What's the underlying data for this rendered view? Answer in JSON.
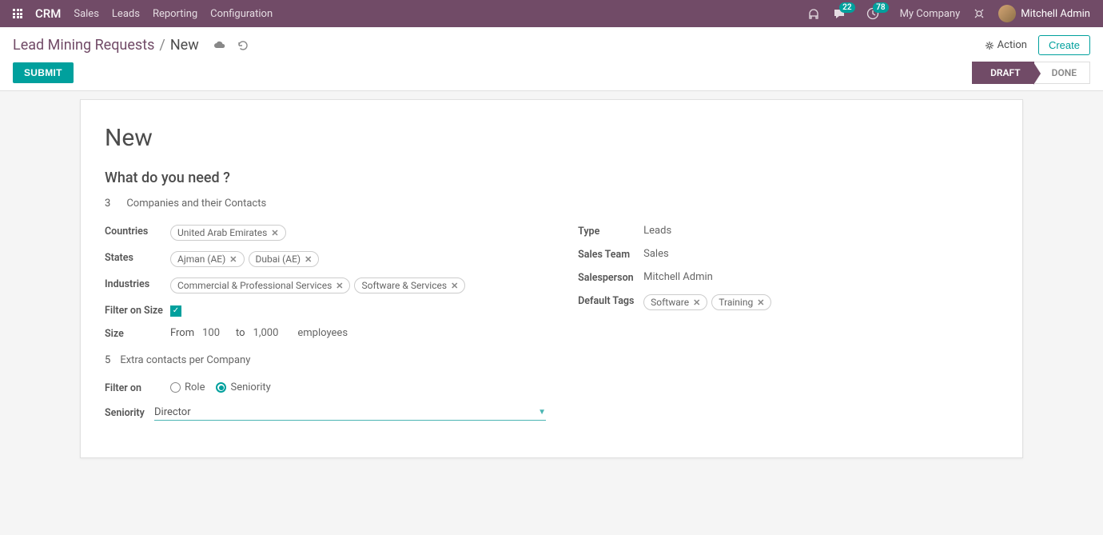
{
  "navbar": {
    "brand": "CRM",
    "links": [
      "Sales",
      "Leads",
      "Reporting",
      "Configuration"
    ],
    "msg_badge": "22",
    "clock_badge": "78",
    "company": "My Company",
    "user": "Mitchell Admin"
  },
  "breadcrumb": {
    "parent": "Lead Mining Requests",
    "current": "New"
  },
  "actions": {
    "action_label": "Action",
    "create_label": "Create"
  },
  "buttons": {
    "submit": "Submit"
  },
  "status": {
    "current": "Draft",
    "next": "Done"
  },
  "form": {
    "title": "New",
    "subtitle": "What do you need ?",
    "count": "3",
    "need_label": "Companies and their Contacts",
    "labels": {
      "countries": "Countries",
      "states": "States",
      "industries": "Industries",
      "filter_size": "Filter on Size",
      "size": "Size",
      "extra_count": "5",
      "extra_label": "Extra contacts per Company",
      "filter_on": "Filter on",
      "seniority": "Seniority",
      "type": "Type",
      "sales_team": "Sales Team",
      "salesperson": "Salesperson",
      "default_tags": "Default Tags"
    },
    "countries": [
      "United Arab Emirates"
    ],
    "states": [
      "Ajman (AE)",
      "Dubai (AE)"
    ],
    "industries": [
      "Commercial & Professional Services",
      "Software & Services"
    ],
    "filter_on_size": true,
    "size_from_label": "From",
    "size_from": "100",
    "size_to_label": "to",
    "size_to": "1,000",
    "size_unit": "employees",
    "filter_on_options": {
      "role": "Role",
      "seniority": "Seniority"
    },
    "filter_on_value": "seniority",
    "seniority_value": "Director",
    "right": {
      "type": "Leads",
      "sales_team": "Sales",
      "salesperson": "Mitchell Admin",
      "tags": [
        "Software",
        "Training"
      ]
    }
  }
}
